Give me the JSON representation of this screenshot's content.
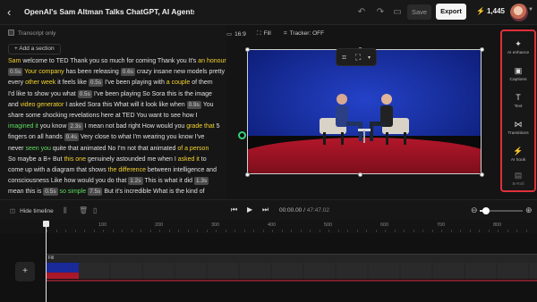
{
  "header": {
    "project_title": "OpenAI's Sam Altman Talks ChatGPT, AI Agents ...",
    "save_label": "Save",
    "export_label": "Export",
    "credits": "1,445"
  },
  "left_panel": {
    "transcript_only_label": "Transcript only",
    "add_section_label": "+ Add a section"
  },
  "transcript": [
    [
      {
        "t": "Sam",
        "c": "hl"
      },
      {
        "t": " welcome to TED Thank you so much for coming Thank you It's "
      },
      {
        "t": "an honour",
        "c": "hl"
      }
    ],
    [
      {
        "t": "0.5s",
        "c": "pill"
      },
      {
        "t": " "
      },
      {
        "t": "Your company",
        "c": "hl"
      },
      {
        "t": " has been releasing "
      },
      {
        "t": "0.6s",
        "c": "pill"
      },
      {
        "t": " crazy insane new models pretty m"
      }
    ],
    [
      {
        "t": "every "
      },
      {
        "t": "other week",
        "c": "hl"
      },
      {
        "t": " it feels like "
      },
      {
        "t": "0.5s",
        "c": "pill"
      },
      {
        "t": " I've been playing with "
      },
      {
        "t": "a couple",
        "c": "hl"
      },
      {
        "t": " of them"
      }
    ],
    [
      {
        "t": "I'd like to show you what "
      },
      {
        "t": "0.5s",
        "c": "pill"
      },
      {
        "t": " I've been playing So Sora this is the image"
      }
    ],
    [
      {
        "t": "and "
      },
      {
        "t": "video generator",
        "c": "hl"
      },
      {
        "t": " I asked Sora this What will it look like when "
      },
      {
        "t": "0.9s",
        "c": "pill"
      },
      {
        "t": " You"
      }
    ],
    [
      {
        "t": "share some shocking revelations here at TED You want to see how I"
      }
    ],
    [
      {
        "t": "imagined it",
        "c": "gn"
      },
      {
        "t": " you know "
      },
      {
        "t": "2.3s",
        "c": "pill"
      },
      {
        "t": " I mean not bad right How would you "
      },
      {
        "t": "grade that",
        "c": "hl"
      },
      {
        "t": " 5"
      }
    ],
    [
      {
        "t": "fingers on all hands "
      },
      {
        "t": "0.4s",
        "c": "pill"
      },
      {
        "t": " Very close to what I'm wearing you know I've"
      }
    ],
    [
      {
        "t": "never "
      },
      {
        "t": "seen you",
        "c": "gn"
      },
      {
        "t": " quite that animated No I'm not that animated "
      },
      {
        "t": "of a person",
        "c": "hl"
      }
    ],
    [
      {
        "t": "So maybe a B+ But "
      },
      {
        "t": "this one",
        "c": "hl"
      },
      {
        "t": " genuinely astounded me when I "
      },
      {
        "t": "asked it",
        "c": "hl"
      },
      {
        "t": " to"
      }
    ],
    [
      {
        "t": "come up with a diagram that shows "
      },
      {
        "t": "the difference",
        "c": "hl"
      },
      {
        "t": " between intelligence and"
      }
    ],
    [
      {
        "t": "consciousness Like how would you do that "
      },
      {
        "t": "1.2s",
        "c": "pill"
      },
      {
        "t": " This is what it did "
      },
      {
        "t": "1.3s",
        "c": "pill"
      }
    ],
    [
      {
        "t": "mean this is "
      },
      {
        "t": "0.5s",
        "c": "pill"
      },
      {
        "t": " "
      },
      {
        "t": "so simple",
        "c": "gn"
      },
      {
        "t": " "
      },
      {
        "t": "7.5s",
        "c": "pill"
      },
      {
        "t": " But it's incredible What is the kind of"
      }
    ]
  ],
  "canvas_toolbar": {
    "aspect": "16:9",
    "fill": "Fill",
    "tracker": "Tracker: OFF"
  },
  "tools": [
    {
      "label": "AI enhance",
      "icon": "sparkle-icon",
      "glyph": "✦"
    },
    {
      "label": "Captions",
      "icon": "captions-icon",
      "glyph": "▣"
    },
    {
      "label": "Text",
      "icon": "text-icon",
      "glyph": "T"
    },
    {
      "label": "Transitions",
      "icon": "transitions-icon",
      "glyph": "⋈"
    },
    {
      "label": "AI hook",
      "icon": "hook-icon",
      "glyph": "⚡"
    },
    {
      "label": "B-Roll",
      "icon": "broll-icon",
      "glyph": "▤"
    }
  ],
  "timeline": {
    "hide_label": "Hide timeline",
    "current_time": "00:00.00",
    "total_time": "47:47.02",
    "zoom_level": 0.15,
    "ruler_labels": [
      "100",
      "200",
      "300",
      "400",
      "500",
      "600",
      "700",
      "800"
    ],
    "clip_label": "Fill"
  },
  "colors": {
    "highlight_yellow": "#f3d231",
    "highlight_green": "#5fdc5f",
    "tool_panel_border": "#e0303a",
    "handle_green": "#36d07a"
  }
}
